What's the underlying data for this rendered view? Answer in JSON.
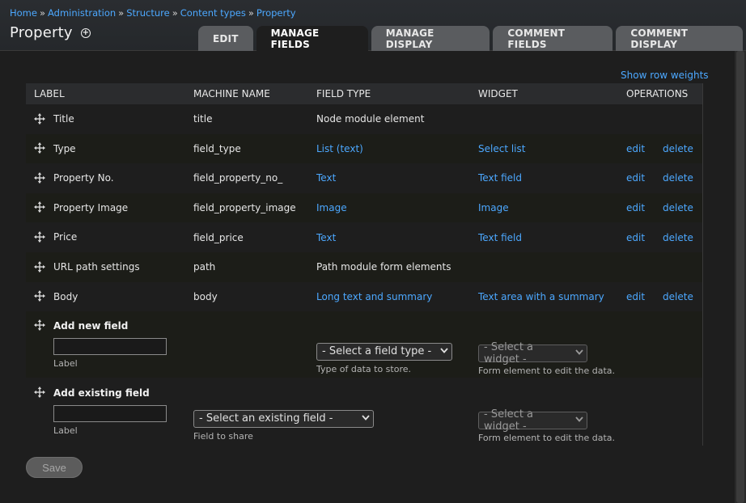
{
  "breadcrumb": [
    "Home",
    "Administration",
    "Structure",
    "Content types",
    "Property"
  ],
  "breadcrumb_separator": "»",
  "page_title": "Property",
  "tabs": [
    {
      "label": "Edit",
      "active": false
    },
    {
      "label": "Manage fields",
      "active": true
    },
    {
      "label": "Manage display",
      "active": false
    },
    {
      "label": "Comment fields",
      "active": false
    },
    {
      "label": "Comment display",
      "active": false
    }
  ],
  "show_row_weights": "Show row weights",
  "columns": [
    "Label",
    "Machine name",
    "Field type",
    "Widget",
    "Operations"
  ],
  "rows": [
    {
      "label": "Title",
      "machine_name": "title",
      "field_type": "Node module element",
      "field_type_link": false,
      "widget": "",
      "edit": "",
      "delete": ""
    },
    {
      "label": "Type",
      "machine_name": "field_type",
      "field_type": "List (text)",
      "field_type_link": true,
      "widget": "Select list",
      "edit": "edit",
      "delete": "delete"
    },
    {
      "label": "Property No.",
      "machine_name": "field_property_no_",
      "field_type": "Text",
      "field_type_link": true,
      "widget": "Text field",
      "edit": "edit",
      "delete": "delete"
    },
    {
      "label": "Property Image",
      "machine_name": "field_property_image",
      "field_type": "Image",
      "field_type_link": true,
      "widget": "Image",
      "edit": "edit",
      "delete": "delete"
    },
    {
      "label": "Price",
      "machine_name": "field_price",
      "field_type": "Text",
      "field_type_link": true,
      "widget": "Text field",
      "edit": "edit",
      "delete": "delete"
    },
    {
      "label": "URL path settings",
      "machine_name": "path",
      "field_type": "Path module form elements",
      "field_type_link": false,
      "widget": "",
      "edit": "",
      "delete": ""
    },
    {
      "label": "Body",
      "machine_name": "body",
      "field_type": "Long text and summary",
      "field_type_link": true,
      "widget": "Text area with a summary",
      "edit": "edit",
      "delete": "delete"
    }
  ],
  "add_new": {
    "title": "Add new field",
    "label_hint": "Label",
    "field_type_select": "- Select a field type -",
    "field_type_hint": "Type of data to store.",
    "widget_select": "- Select a widget -",
    "widget_hint": "Form element to edit the data."
  },
  "add_existing": {
    "title": "Add existing field",
    "label_hint": "Label",
    "existing_select": "- Select an existing field -",
    "existing_hint": "Field to share",
    "widget_select": "- Select a widget -",
    "widget_hint": "Form element to edit the data."
  },
  "save_label": "Save",
  "colors": {
    "link": "#4ca8ff",
    "background": "#1e1e1e",
    "tab": "#5a5c5f"
  },
  "icons": {
    "drag": "drag-handle-icon",
    "add_shortcut": "add-shortcut-icon",
    "chevron": "chevron-down-icon"
  }
}
